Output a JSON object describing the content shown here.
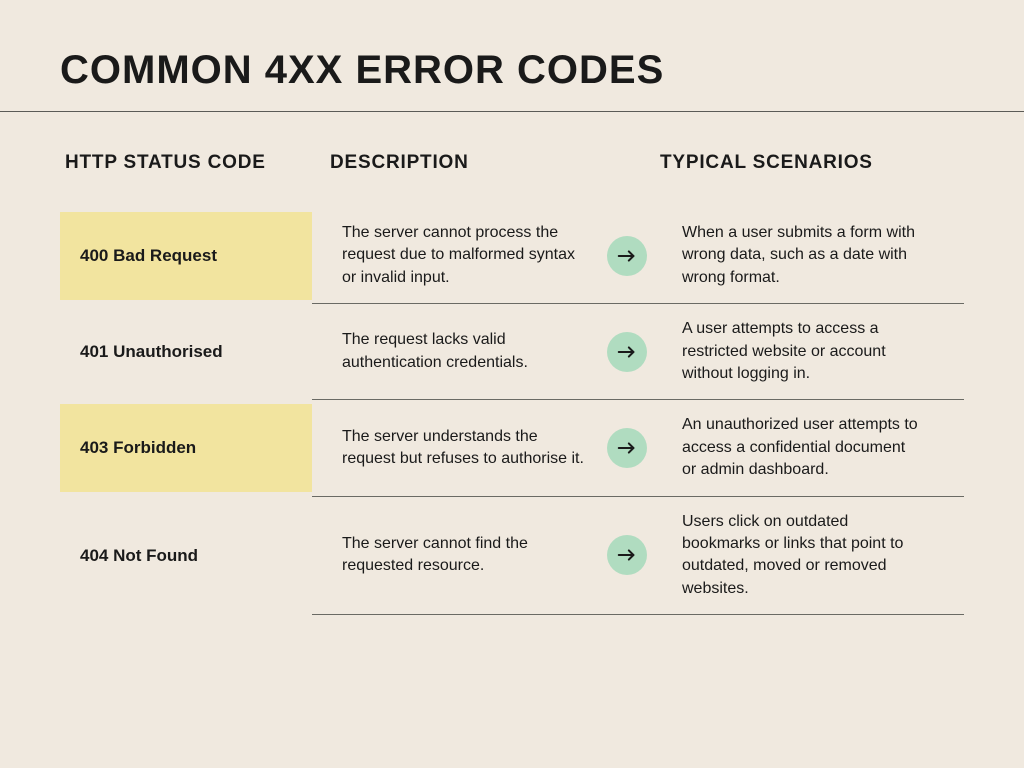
{
  "title": "COMMON 4XX ERROR CODES",
  "headers": {
    "code": "HTTP STATUS CODE",
    "description": "DESCRIPTION",
    "scenarios": "TYPICAL SCENARIOS"
  },
  "rows": [
    {
      "code": "400 Bad Request",
      "highlight": true,
      "description": "The server cannot process the request due to malformed syntax or invalid input.",
      "scenario": "When a user submits a form with wrong data, such as a date with wrong format."
    },
    {
      "code": "401 Unauthorised",
      "highlight": false,
      "description": "The request lacks valid authentication credentials.",
      "scenario": "A user attempts to access a restricted website or account without logging in."
    },
    {
      "code": "403 Forbidden",
      "highlight": true,
      "description": "The server understands the request but refuses to authorise it.",
      "scenario": "An unauthorized user attempts to access a confidential document or admin dashboard."
    },
    {
      "code": "404 Not Found",
      "highlight": false,
      "description": "The server cannot find the requested resource.",
      "scenario": "Users click on outdated bookmarks or links that point to outdated, moved or removed websites."
    }
  ]
}
